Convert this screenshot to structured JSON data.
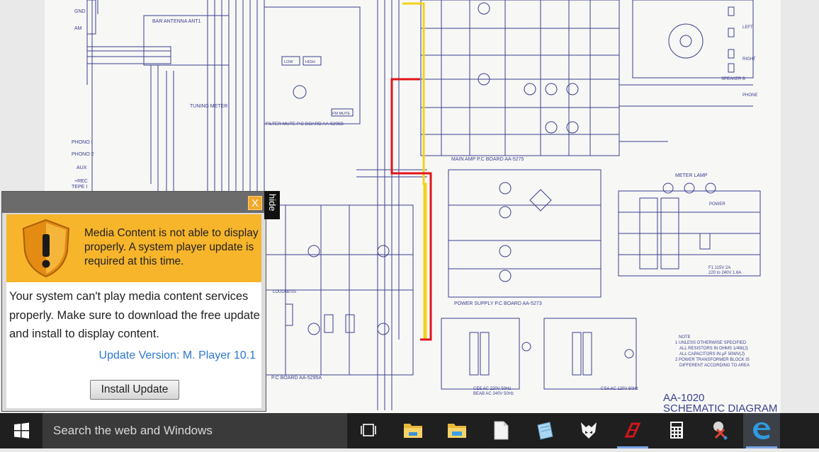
{
  "schematic": {
    "title_line1": "AA-1020",
    "title_line2": "SCHEMATIC DIAGRAM",
    "labels": {
      "bar_antenna": "BAR ANTENNA ANT1",
      "gnd": "GND",
      "am": "AM",
      "filter_board": "FILTER MUTE P.C BOARD AA-5295B",
      "tuning_meter": "TUNING METER",
      "phono1": "PHONO I",
      "phono2": "PHONO 2",
      "aux": "AUX",
      "rec": "+REC",
      "tepe": "TEPE I",
      "main_amp": "MAIN AMP P.C BOARD AA-5275",
      "power_supply": "POWER SUPPLY P.C BOARD AA-5273",
      "pc_board": "P.C BOARD AA-5295A",
      "loudness": "LOUDNESS",
      "meter_lamp": "METER LAMP",
      "speaker_b": "SPEAKER B",
      "left": "LEFT",
      "right": "RIGHT",
      "phone": "PHONE",
      "power": "POWER",
      "low": "LOW",
      "high": "HIGH",
      "fm_mute": "FM MUTE",
      "note_head": "NOTE",
      "note1": "1 UNLESS OTHERWISE SPECIFIED",
      "note1b": "ALL RESISTORS IN OHMS 1/4W(J)",
      "note1c": "ALL CAPACITORS IN µF 50WV(J)",
      "note2": "2 POWER TRANSFORMER BLOCK IS",
      "note2b": "DIFFERENT ACCORDING TO AREA",
      "cee": "CEE AC 220V 50Hz",
      "bear": "BEAB AC 240V 50Hz",
      "csa": "CSA AC 120V 60Hz",
      "ac_note": "F1 115V 2A",
      "ac_note2": "220 to 240V 1.6A"
    }
  },
  "popup": {
    "close_label": "X",
    "hide_label": "hide",
    "warning_text": "Media Content is not able to display properly. A system player update is required at this time.",
    "body_text": "Your system can't play media content services properly. Make sure to download the free update and install to display content.",
    "version_text": "Update Version: M. Player 10.1",
    "install_button": "Install Update"
  },
  "taskbar": {
    "search_placeholder": "Search the web and Windows",
    "icons": [
      "task-view-icon",
      "file-explorer-icon",
      "folder-icon",
      "document-icon",
      "notepad-icon",
      "firefox-icon",
      "app-red-icon",
      "calculator-icon",
      "snipping-tool-icon",
      "edge-icon"
    ]
  },
  "colors": {
    "taskbar_bg": "#1f1f1f",
    "search_bg": "#3a3a3a",
    "popup_warning": "#f7b52b",
    "link_blue": "#2f78d0",
    "schematic_ink": "#3b3f8f",
    "highlight_yellow": "#f2d31c",
    "highlight_red": "#e0141c"
  }
}
